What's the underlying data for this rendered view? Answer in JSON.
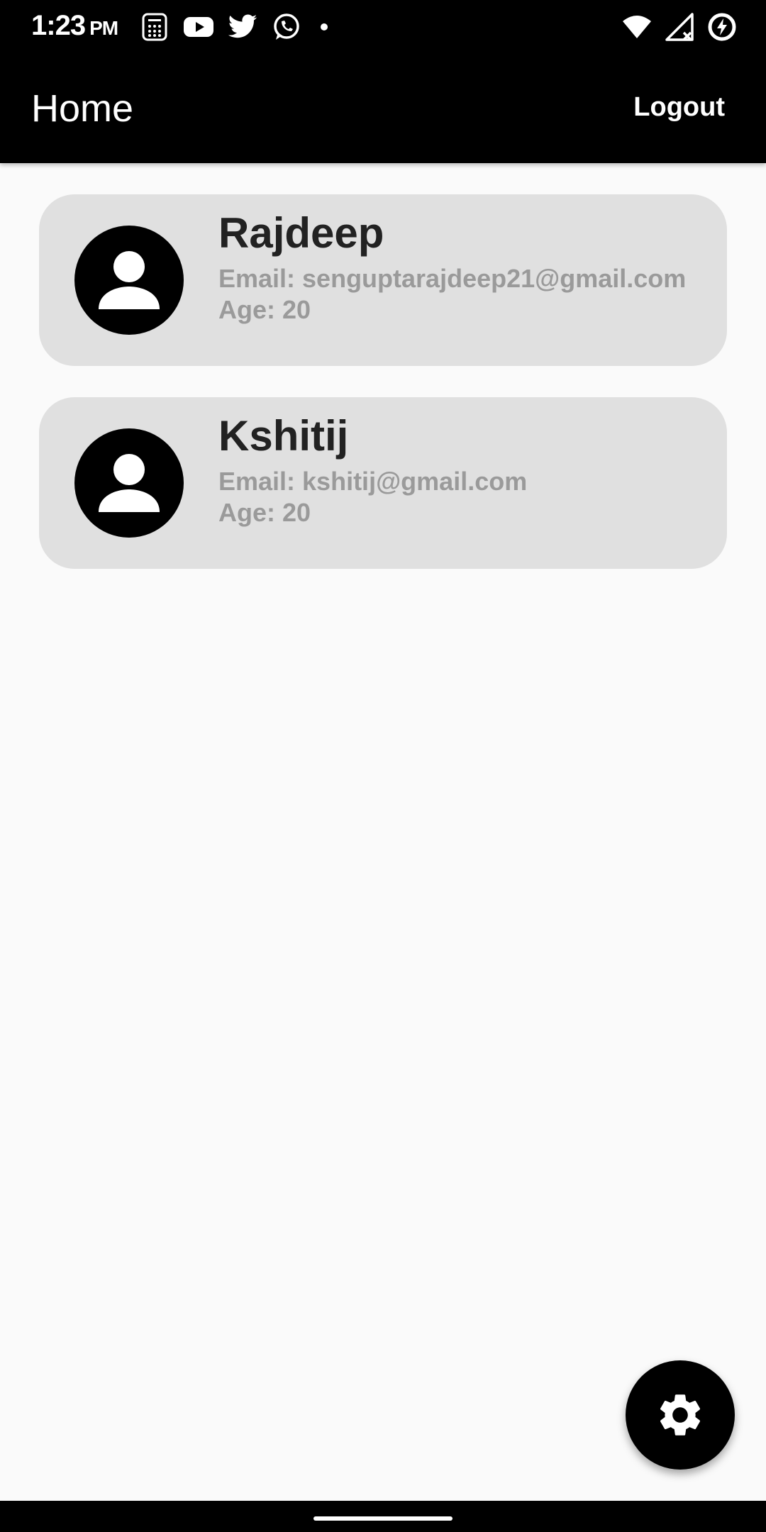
{
  "status_bar": {
    "time": "1:23",
    "ampm": "PM",
    "left_icons": [
      "calculator-icon",
      "youtube-icon",
      "twitter-icon",
      "whatsapp-icon",
      "dot-icon"
    ],
    "right_icons": [
      "wifi-icon",
      "signal-icon",
      "battery-charging-icon"
    ]
  },
  "app_bar": {
    "title": "Home",
    "logout_label": "Logout"
  },
  "users": [
    {
      "name": "Rajdeep",
      "email": "Email: senguptarajdeep21@gmail.com",
      "age": "Age: 20",
      "avatar_icon": "person-icon"
    },
    {
      "name": "Kshitij",
      "email": "Email: kshitij@gmail.com",
      "age": "Age: 20",
      "avatar_icon": "person-icon"
    }
  ],
  "fab": {
    "icon": "gear-icon"
  },
  "colors": {
    "app_bar": "#000000",
    "background": "#fafafa",
    "card": "#e0e0e0",
    "name_text": "#222222",
    "detail_text": "#9a9a9a"
  }
}
